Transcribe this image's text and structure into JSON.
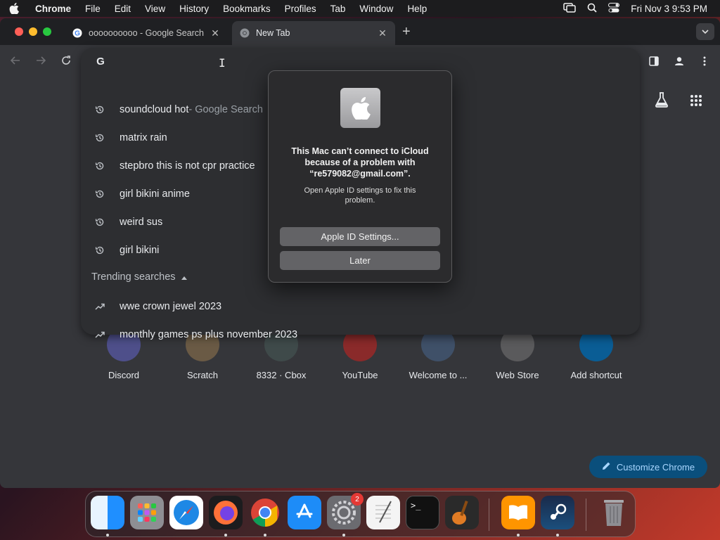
{
  "menubar": {
    "app_name": "Chrome",
    "items": [
      "File",
      "Edit",
      "View",
      "History",
      "Bookmarks",
      "Profiles",
      "Tab",
      "Window",
      "Help"
    ],
    "clock": "Fri Nov 3  9:53 PM"
  },
  "tabs": [
    {
      "title": "oooooooooo - Google Search",
      "icon": "google-g-icon"
    },
    {
      "title": "New Tab",
      "icon": "chrome-icon"
    }
  ],
  "omnibox": {
    "suggestions": [
      {
        "text": "soundcloud hot",
        "suffix": " - Google Search",
        "icon": "history-icon"
      },
      {
        "text": "matrix rain",
        "suffix": "",
        "icon": "history-icon"
      },
      {
        "text": "stepbro this is not cpr practice",
        "suffix": "",
        "icon": "history-icon"
      },
      {
        "text": "girl bikini anime",
        "suffix": "",
        "icon": "history-icon"
      },
      {
        "text": "weird sus",
        "suffix": "",
        "icon": "history-icon"
      },
      {
        "text": "girl bikini",
        "suffix": "",
        "icon": "history-icon"
      }
    ],
    "trending_header": "Trending searches",
    "trending": [
      {
        "text": "wwe crown jewel 2023",
        "icon": "trending-icon"
      },
      {
        "text": "monthly games ps plus november 2023",
        "icon": "trending-icon"
      }
    ]
  },
  "shortcuts": [
    "Discord",
    "Scratch",
    "8332 · Cbox",
    "YouTube",
    "Welcome to ...",
    "Web Store",
    "Add shortcut"
  ],
  "customize_label": "Customize Chrome",
  "dialog": {
    "title": "This Mac can’t connect to iCloud because of a problem with “re579082@gmail.com”.",
    "message": "Open Apple ID settings to fix this problem.",
    "primary_button": "Apple ID Settings...",
    "secondary_button": "Later"
  },
  "dock": {
    "apps": [
      "Finder",
      "Launchpad",
      "Safari",
      "Firefox",
      "Chrome",
      "App Store",
      "System Settings",
      "TextEdit",
      "Terminal",
      "GarageBand",
      "Books",
      "Steam",
      "Trash"
    ],
    "system_settings_badge": "2"
  }
}
